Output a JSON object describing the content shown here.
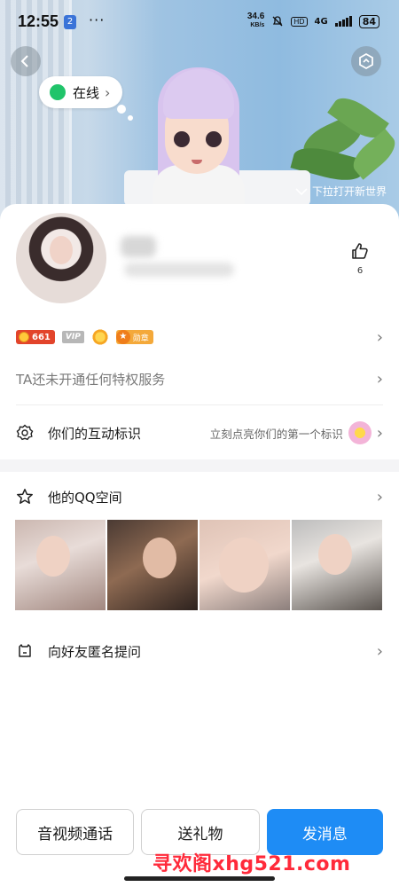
{
  "statusbar": {
    "time": "12:55",
    "notif_badge": "2",
    "more_dots": "···",
    "net_speed_top": "34.6",
    "net_speed_bottom": "KB/s",
    "hd_label": "HD",
    "network": "4G",
    "battery": "84"
  },
  "header": {
    "online_status": "在线",
    "pull_hint": "下拉打开新世界"
  },
  "profile": {
    "like_count": "6",
    "level_value": "661",
    "vip_label": "VIP",
    "medal_label": "勋章",
    "privilege_text": "TA还未开通任何特权服务"
  },
  "interaction": {
    "title": "你们的互动标识",
    "hint": "立刻点亮你们的第一个标识"
  },
  "qzone": {
    "title": "他的QQ空间"
  },
  "anonymous": {
    "title": "向好友匿名提问"
  },
  "actions": {
    "call": "音视频通话",
    "gift": "送礼物",
    "message": "发消息"
  },
  "watermark": "寻欢阁xhg521.com",
  "colors": {
    "primary": "#1e8cf5",
    "online": "#20c46a",
    "level_badge": "#e2442b",
    "watermark": "#ff2a3a"
  }
}
